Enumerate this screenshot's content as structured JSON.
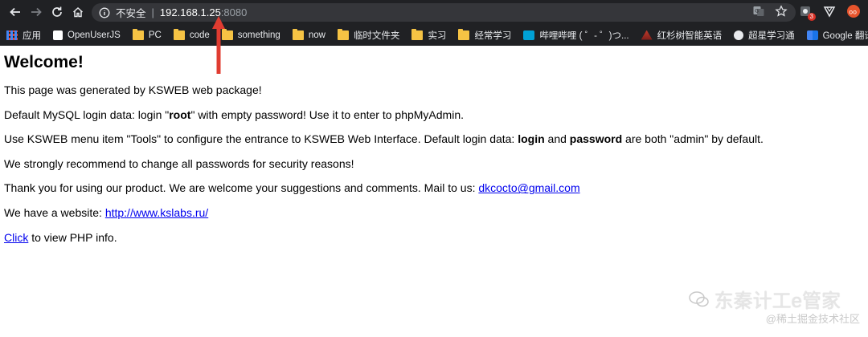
{
  "browser": {
    "security_label": "不安全",
    "url_host": "192.168.1.25",
    "url_port": ":8080",
    "extension_badge": "3"
  },
  "bookmarks": [
    {
      "label": "应用",
      "icon": "apps-grid-icon"
    },
    {
      "label": "OpenUserJS",
      "icon": "site-icon"
    },
    {
      "label": "PC",
      "icon": "folder-icon"
    },
    {
      "label": "code",
      "icon": "folder-icon"
    },
    {
      "label": "something",
      "icon": "folder-icon"
    },
    {
      "label": "now",
      "icon": "folder-icon"
    },
    {
      "label": "临时文件夹",
      "icon": "folder-icon"
    },
    {
      "label": "实习",
      "icon": "folder-icon"
    },
    {
      "label": "经常学习",
      "icon": "folder-icon"
    },
    {
      "label": "哔哩哔哩 ( ゜- ゜)つ...",
      "icon": "bilibili-icon"
    },
    {
      "label": "红杉树智能英语",
      "icon": "tree-icon"
    },
    {
      "label": "超星学习通",
      "icon": "globe-icon"
    },
    {
      "label": "Google 翻译",
      "icon": "translate-icon"
    }
  ],
  "page": {
    "title": "Welcome!",
    "p1": "This page was generated by KSWEB web package!",
    "p2_a": "Default MySQL login data: login \"",
    "p2_b": "root",
    "p2_c": "\" with empty password! Use it to enter to phpMyAdmin.",
    "p3_a": "Use KSWEB menu item \"Tools\" to configure the entrance to KSWEB Web Interface. Default login data: ",
    "p3_b": "login",
    "p3_c": " and ",
    "p3_d": "password",
    "p3_e": " are both \"admin\" by default.",
    "p4": "We strongly recommend to change all passwords for security reasons!",
    "p5_a": "Thank you for using our product. We are welcome your suggestions and comments. Mail to us: ",
    "p5_link": "dkcocto@gmail.com",
    "p6_a": "We have a website: ",
    "p6_link": "http://www.kslabs.ru/",
    "p7_link": "Click",
    "p7_b": " to view PHP info."
  },
  "watermark": {
    "line1": "东秦计工e管家",
    "line2": "@稀土掘金技术社区"
  },
  "colors": {
    "link": "#0000ee",
    "annotation_arrow": "#e03c31",
    "chrome_dark": "#202124"
  }
}
